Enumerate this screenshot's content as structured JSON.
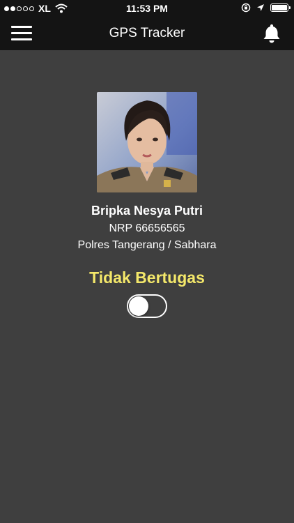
{
  "status_bar": {
    "carrier": "XL",
    "time": "11:53 PM",
    "signal_bars_filled": 2,
    "signal_bars_total": 5,
    "battery_level": 1.0
  },
  "nav": {
    "title": "GPS Tracker",
    "menu_icon": "hamburger-menu-icon",
    "notification_icon": "bell-icon"
  },
  "profile": {
    "name": "Bripka Nesya Putri",
    "nrp": "NRP 66656565",
    "unit": "Polres Tangerang / Sabhara"
  },
  "duty": {
    "status_label": "Tidak Bertugas",
    "toggle_on": false
  },
  "colors": {
    "background": "#3f3f3f",
    "bar": "#141414",
    "status_label": "#f4e86a"
  }
}
